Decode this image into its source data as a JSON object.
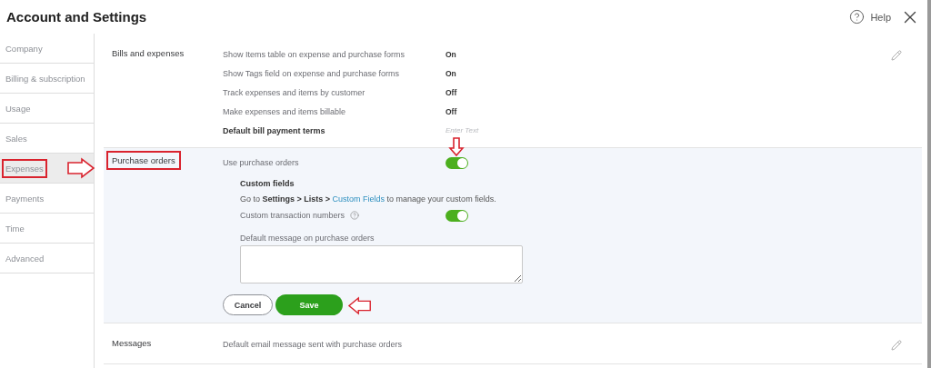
{
  "header": {
    "title": "Account and Settings",
    "help": "Help"
  },
  "sidebar": [
    {
      "label": "Company",
      "selected": false,
      "marked": false
    },
    {
      "label": "Billing & subscription",
      "selected": false,
      "marked": false
    },
    {
      "label": "Usage",
      "selected": false,
      "marked": false
    },
    {
      "label": "Sales",
      "selected": false,
      "marked": false
    },
    {
      "label": "Expenses",
      "selected": true,
      "marked": true
    },
    {
      "label": "Payments",
      "selected": false,
      "marked": false
    },
    {
      "label": "Time",
      "selected": false,
      "marked": false
    },
    {
      "label": "Advanced",
      "selected": false,
      "marked": false
    }
  ],
  "sections": [
    {
      "kind": "summary",
      "title": "Bills and expenses",
      "marked": false,
      "rows": [
        {
          "kind": "setting",
          "label": "Show Items table on expense and purchase forms",
          "value": "On"
        },
        {
          "kind": "setting",
          "label": "Show Tags field on expense and purchase forms",
          "value": "On"
        },
        {
          "kind": "setting",
          "label": "Track expenses and items by customer",
          "value": "Off"
        },
        {
          "kind": "setting",
          "label": "Make expenses and items billable",
          "value": "Off"
        },
        {
          "kind": "field",
          "label": "Default bill payment terms",
          "placeholder": "Enter Text"
        }
      ]
    },
    {
      "kind": "form",
      "title": "Purchase orders",
      "marked": true,
      "use_toggle": {
        "label": "Use purchase orders",
        "on": true,
        "marked": true
      },
      "custom_fields": {
        "heading": "Custom fields",
        "text": "Go to **Settings > Lists >** ",
        "link": "Custom Fields",
        "after": " to manage your custom fields."
      },
      "number_toggle": {
        "label": "Custom transaction numbers",
        "on": true
      },
      "message": {
        "label": "Default message on purchase orders"
      },
      "cancel": {
        "label": "Cancel"
      },
      "save": {
        "label": "Save",
        "marked": true
      }
    },
    {
      "kind": "summary",
      "title": "Messages",
      "marked": false,
      "rows": [
        {
          "kind": "plain",
          "label": "Default email message sent with purchase orders"
        }
      ]
    }
  ]
}
